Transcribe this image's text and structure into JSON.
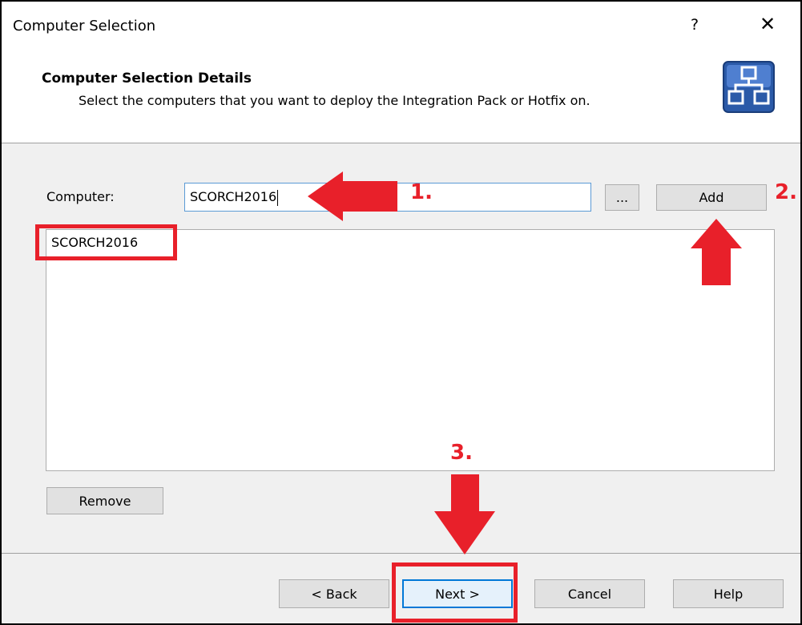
{
  "window": {
    "title": "Computer Selection",
    "help_label": "?",
    "close_label": "✕"
  },
  "header": {
    "title": "Computer Selection Details",
    "subtitle": "Select the computers that you want to deploy the Integration Pack or Hotfix on.",
    "icon": "network-deploy-icon"
  },
  "form": {
    "computer_label": "Computer:",
    "computer_value": "SCORCH2016",
    "browse_label": "...",
    "add_label": "Add",
    "remove_label": "Remove"
  },
  "computer_list": {
    "items": [
      "SCORCH2016"
    ]
  },
  "buttons": {
    "back": "< Back",
    "next": "Next >",
    "cancel": "Cancel",
    "help": "Help"
  },
  "annotations": {
    "step1": "1.",
    "step2": "2.",
    "step3": "3.",
    "color": "#e8202a"
  }
}
